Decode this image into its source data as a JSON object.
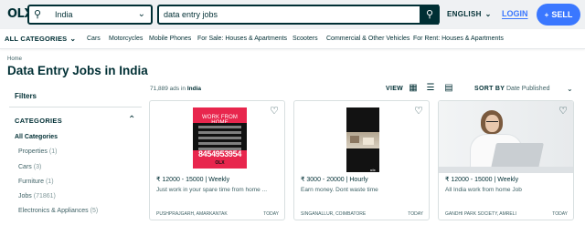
{
  "header": {
    "logo_text": "OLX",
    "location": {
      "value": "India",
      "search_icon": "search-icon",
      "chevron": "chevron-down-icon"
    },
    "search": {
      "value": "data entry jobs",
      "button_icon": "search-icon"
    },
    "language": "ENGLISH",
    "login": "LOGIN",
    "sell": "SELL"
  },
  "categories_bar": {
    "all_label": "ALL CATEGORIES",
    "links": [
      "Cars",
      "Motorcycles",
      "Mobile Phones",
      "For Sale: Houses & Apartments",
      "Scooters",
      "Commercial & Other Vehicles",
      "For Rent: Houses & Apartments"
    ]
  },
  "breadcrumb": "Home",
  "page_title": "Data Entry Jobs in India",
  "sidebar": {
    "filters_label": "Filters",
    "categories_label": "CATEGORIES",
    "all_categories": "All Categories",
    "items": [
      {
        "name": "Properties",
        "count": "(1)"
      },
      {
        "name": "Cars",
        "count": "(3)"
      },
      {
        "name": "Furniture",
        "count": "(1)"
      },
      {
        "name": "Jobs",
        "count": "(71861)"
      },
      {
        "name": "Electronics & Appliances",
        "count": "(5)"
      }
    ]
  },
  "results": {
    "count_prefix": "71,889 ads in",
    "count_location": "India",
    "view_label": "VIEW",
    "sort_label": "SORT BY",
    "sort_value": "Date Published"
  },
  "ads": [
    {
      "price": "₹ 12000 - 15000 | Weekly",
      "description": "Just work in your spare time from home ...",
      "location": "PUSHPRAJGARH, AMARKANTAK",
      "date": "TODAY",
      "image_text": {
        "line1": "WORK FROM HOME",
        "phone": "8454953954",
        "brand": "OLX"
      }
    },
    {
      "price": "₹ 3000 - 20000 | Hourly",
      "description": "Earn money. Dont waste time",
      "location": "SINGANALLUR, COIMBATORE",
      "date": "TODAY"
    },
    {
      "price": "₹ 12000 - 15000 | Weekly",
      "description": "All India work from home Job",
      "location": "GANDHI PARK SOCIETY, AMRELI",
      "date": "TODAY"
    }
  ]
}
